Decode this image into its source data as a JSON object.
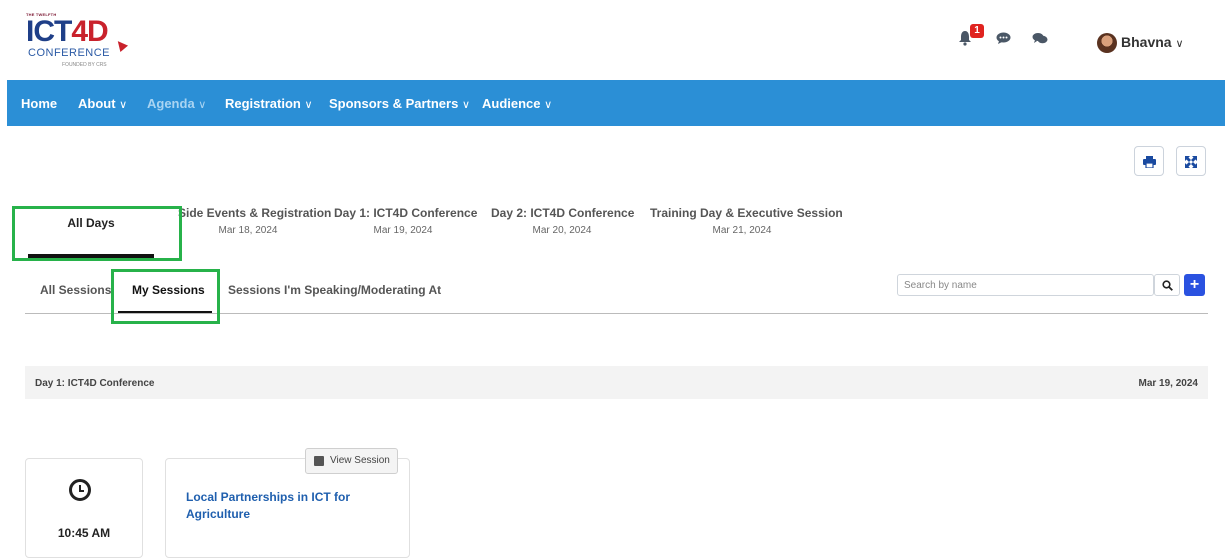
{
  "header": {
    "logo": {
      "top_text": "THE TWELFTH",
      "main_text_a": "ICT",
      "main_text_b": "4D",
      "sub_text": "CONFERENCE",
      "founded_text": "FOUNDED BY CRS"
    },
    "notification_count": "1",
    "user_name": "Bhavna"
  },
  "nav": {
    "items": [
      {
        "label": "Home",
        "has_dropdown": false
      },
      {
        "label": "About",
        "has_dropdown": true
      },
      {
        "label": "Agenda",
        "has_dropdown": true
      },
      {
        "label": "Registration",
        "has_dropdown": true
      },
      {
        "label": "Sponsors & Partners",
        "has_dropdown": true
      },
      {
        "label": "Audience",
        "has_dropdown": true
      }
    ],
    "dropdown_glyph": "∨"
  },
  "day_tabs": [
    {
      "title": "All Days",
      "date": ""
    },
    {
      "title": "Side Events & Registration",
      "date": "Mar 18, 2024"
    },
    {
      "title": "Day 1: ICT4D Conference",
      "date": "Mar 19, 2024"
    },
    {
      "title": "Day 2: ICT4D Conference",
      "date": "Mar 20, 2024"
    },
    {
      "title": "Training Day & Executive Session",
      "date": "Mar 21, 2024"
    }
  ],
  "session_tabs": [
    {
      "label": "All Sessions"
    },
    {
      "label": "My Sessions"
    },
    {
      "label": "Sessions I'm Speaking/Moderating At"
    }
  ],
  "search": {
    "placeholder": "Search by name",
    "value": ""
  },
  "add_label": "+",
  "day_section": {
    "title": "Day 1: ICT4D Conference",
    "date": "Mar 19, 2024"
  },
  "session": {
    "time": "10:45 AM",
    "title": "Local Partnerships in ICT for Agriculture",
    "view_button": "View Session"
  },
  "colors": {
    "nav_bg": "#2b8fd6",
    "highlight_box": "#27b24a",
    "session_title": "#1f5fae",
    "add_button": "#2a52e0",
    "badge": "#e0231f"
  },
  "icons": {
    "bell": "bell-icon",
    "comment": "comment-icon",
    "comments": "comments-icon",
    "print": "print-icon",
    "expand": "expand-icon",
    "search": "search-icon",
    "clock": "clock-icon",
    "edit": "edit-icon"
  }
}
